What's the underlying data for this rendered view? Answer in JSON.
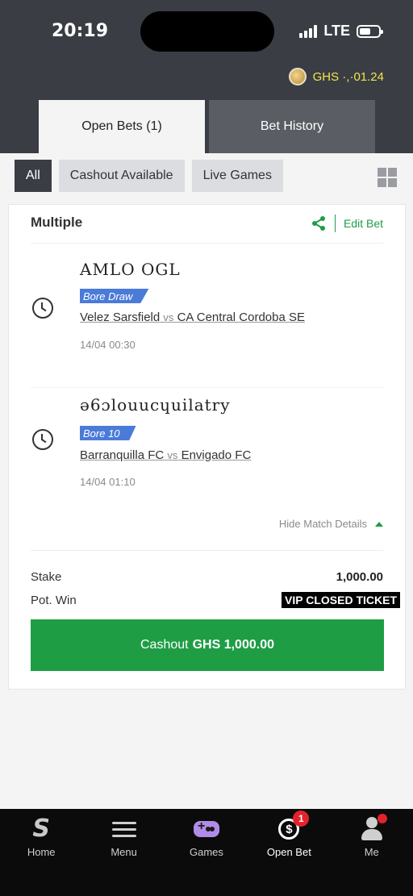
{
  "status_bar": {
    "time": "20:19",
    "network": "LTE"
  },
  "account": {
    "balance_text": "GHS ·,·01.24"
  },
  "tabs": [
    {
      "label": "Open Bets (1)",
      "active": true
    },
    {
      "label": "Bet History",
      "active": false
    }
  ],
  "filters": [
    {
      "label": "All",
      "active": true
    },
    {
      "label": "Cashout Available",
      "active": false
    },
    {
      "label": "Live Games",
      "active": false
    }
  ],
  "bet": {
    "type_label": "Multiple",
    "edit_label": "Edit Bet",
    "selections": [
      {
        "pick": "AMLO OGL",
        "market": "Bore Draw",
        "home": "Velez Sarsfield",
        "vs": "vs",
        "away": "CA Central Cordoba SE",
        "kickoff": "14/04 00:30"
      },
      {
        "pick": "ə6ɔlouucɥuilatry",
        "market": "Bore 10",
        "home": "Barranquilla FC",
        "vs": "vs",
        "away": "Envigado FC",
        "kickoff": "14/04 01:10"
      }
    ],
    "hide_details_label": "Hide Match Details",
    "stake_label": "Stake",
    "stake_value": "1,000.00",
    "pot_win_label": "Pot. Win",
    "pot_win_value": "VIP CLOSED TICKET",
    "cashout_prefix": "Cashout",
    "cashout_amount": "GHS 1,000.00"
  },
  "bottom_nav": [
    {
      "label": "Home",
      "icon": "sportybet-s-icon"
    },
    {
      "label": "Menu",
      "icon": "menu-icon"
    },
    {
      "label": "Games",
      "icon": "gamepad-icon"
    },
    {
      "label": "Open Bet",
      "icon": "cashout-icon",
      "badge": "1",
      "active": true
    },
    {
      "label": "Me",
      "icon": "user-icon"
    }
  ],
  "colors": {
    "brand_green": "#1f9d45",
    "header": "#3a3d44",
    "market_blue": "#4b7bd8",
    "badge_red": "#e3232a"
  }
}
